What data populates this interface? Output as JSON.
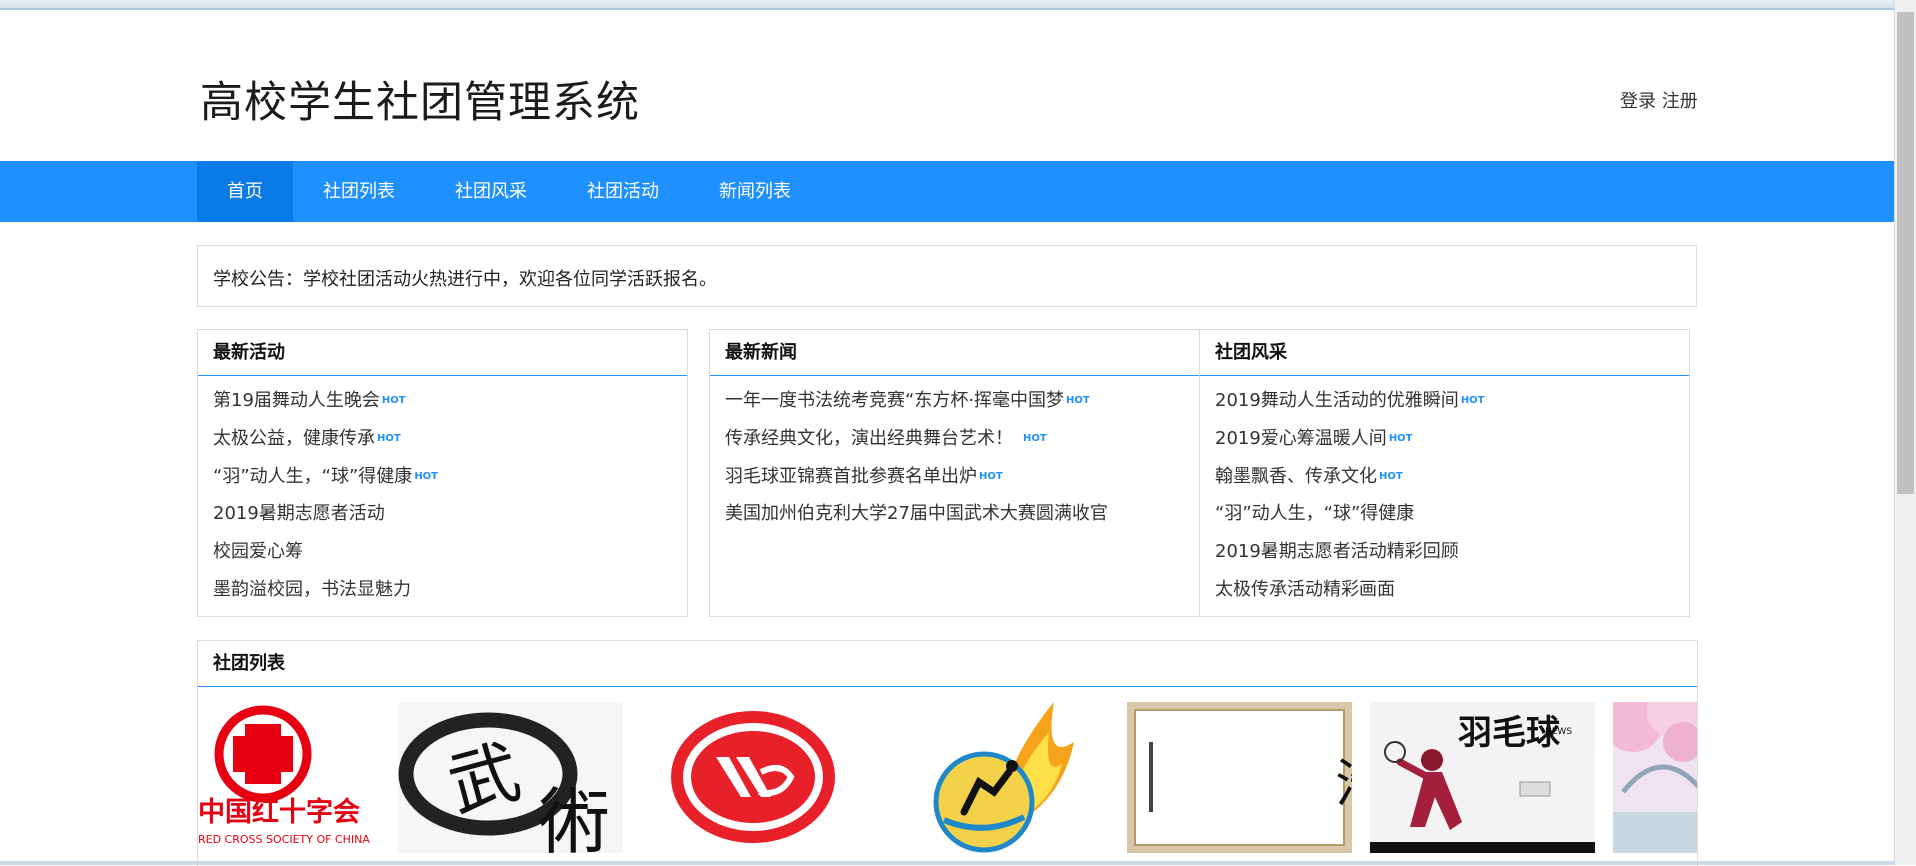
{
  "app": {
    "title": "高校学生社团管理系统",
    "login_label": "登录",
    "register_label": "注册"
  },
  "nav": {
    "items": [
      {
        "label": "首页",
        "active": true
      },
      {
        "label": "社团列表",
        "active": false
      },
      {
        "label": "社团风采",
        "active": false
      },
      {
        "label": "社团活动",
        "active": false
      },
      {
        "label": "新闻列表",
        "active": false
      }
    ]
  },
  "notice": {
    "text": "学校公告：学校社团活动火热进行中，欢迎各位同学活跃报名。"
  },
  "hot_label": "HOT",
  "panels": {
    "activities": {
      "title": "最新活动",
      "items": [
        {
          "text": "第19届舞动人生晚会",
          "hot": true
        },
        {
          "text": "太极公益，健康传承",
          "hot": true
        },
        {
          "text": "“羽”动人生，“球”得健康",
          "hot": true
        },
        {
          "text": "2019暑期志愿者活动",
          "hot": false
        },
        {
          "text": "校园爱心筹",
          "hot": false
        },
        {
          "text": "墨韵溢校园，书法显魅力",
          "hot": false
        }
      ]
    },
    "news": {
      "title": "最新新闻",
      "items": [
        {
          "text": "一年一度书法统考竞赛“东方杯·挥毫中国梦",
          "hot": true
        },
        {
          "text": "传承经典文化，演出经典舞台艺术！",
          "hot": true
        },
        {
          "text": "羽毛球亚锦赛首批参赛名单出炉",
          "hot": true
        },
        {
          "text": "美国加州伯克利大学27届中国武术大赛圆满收官",
          "hot": false
        }
      ]
    },
    "style": {
      "title": "社团风采",
      "items": [
        {
          "text": "2019舞动人生活动的优雅瞬间",
          "hot": true
        },
        {
          "text": "2019爱心筹温暖人间",
          "hot": true
        },
        {
          "text": "翰墨飘香、传承文化",
          "hot": true
        },
        {
          "text": "“羽”动人生，“球”得健康",
          "hot": false
        },
        {
          "text": "2019暑期志愿者活动精彩回顾",
          "hot": false
        },
        {
          "text": "太极传承活动精彩画面",
          "hot": false
        }
      ]
    }
  },
  "clubs": {
    "title": "社团列表",
    "images": [
      {
        "icon": "red-cross-logo",
        "caption_top": "中国红十字会",
        "caption_bottom": "RED CROSS SOCIETY OF CHINA"
      },
      {
        "icon": "wushu-calligraphy-image",
        "caption_top": "武",
        "caption_bottom": "術"
      },
      {
        "icon": "youth-volunteer-association-logo",
        "caption_top": "",
        "caption_bottom": ""
      },
      {
        "icon": "basketball-flame-image",
        "caption_top": "",
        "caption_bottom": ""
      },
      {
        "icon": "calligraphy-scroll-image",
        "caption_top": "浩然正氣",
        "caption_bottom": ""
      },
      {
        "icon": "badminton-poster-image",
        "caption_top": "羽毛球",
        "caption_bottom": "NEWS"
      },
      {
        "icon": "cherry-blossom-bridge-image",
        "caption_top": "",
        "caption_bottom": ""
      }
    ]
  },
  "colors": {
    "nav_bg": "#1e90ff",
    "nav_active": "#0a7ae6",
    "hot": "#1e90ff",
    "red_cross": "#e60012"
  }
}
